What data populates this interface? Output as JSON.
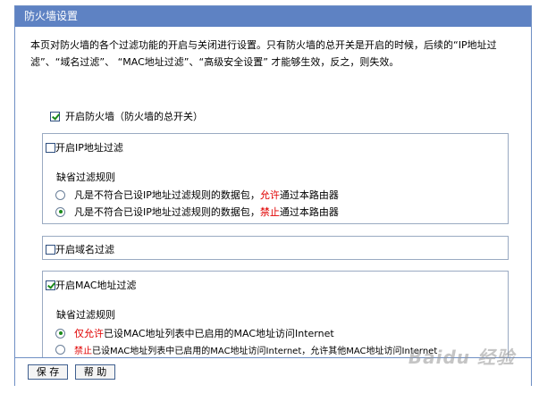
{
  "window": {
    "title": "防火墙设置"
  },
  "description": "本页对防火墙的各个过滤功能的开启与关闭进行设置。只有防火墙的总开关是开启的时候，后续的“IP地址过滤”、“域名过滤”、 “MAC地址过滤”、“高级安全设置” 才能够生效，反之，则失效。",
  "firewall": {
    "label": "开启防火墙（防火墙的总开关）",
    "checked": true
  },
  "ip_filter": {
    "label": "开启IP地址过滤",
    "checked": false,
    "default_rule_label": "缺省过滤规则",
    "option1": {
      "prefix": "凡是不符合已设IP地址过滤规则的数据包，",
      "highlight": "允许",
      "suffix": "通过本路由器",
      "selected": false
    },
    "option2": {
      "prefix": "凡是不符合已设IP地址过滤规则的数据包，",
      "highlight": "禁止",
      "suffix": "通过本路由器",
      "selected": true
    }
  },
  "domain_filter": {
    "label": "开启域名过滤",
    "checked": false
  },
  "mac_filter": {
    "label": "开启MAC地址过滤",
    "checked": true,
    "default_rule_label": "缺省过滤规则",
    "option1": {
      "highlight": "仅允许",
      "suffix": "已设MAC地址列表中已启用的MAC地址访问Internet",
      "selected": true
    },
    "option2": {
      "highlight": "禁止",
      "suffix": "已设MAC地址列表中已启用的MAC地址访问Internet，允许其他MAC地址访问Internet",
      "selected": false
    }
  },
  "buttons": {
    "save": "保 存",
    "help": "帮 助"
  },
  "watermark": "Baidu 经验",
  "colors": {
    "title_bar": "#5e82c3",
    "highlight": "#e00000",
    "check": "#1a8a1a"
  }
}
